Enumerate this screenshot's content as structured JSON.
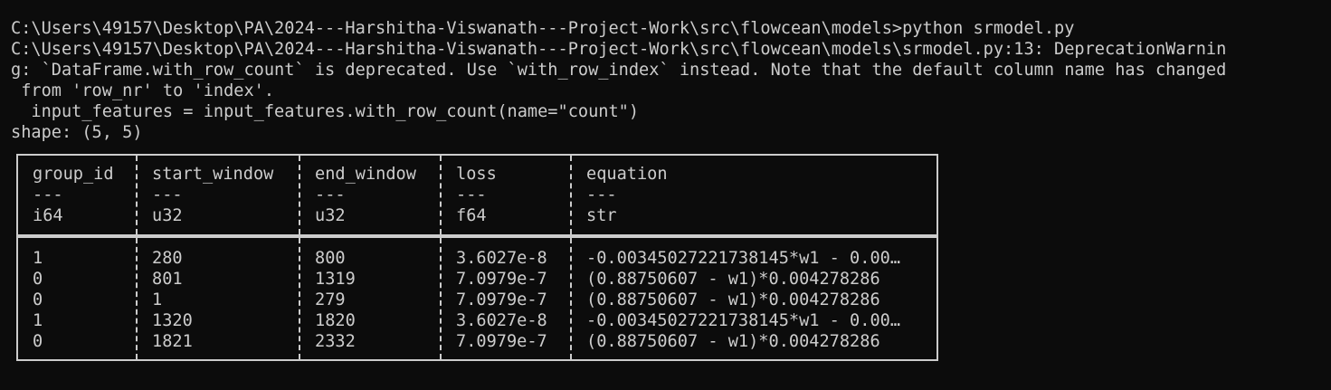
{
  "terminal": {
    "lines": [
      "C:\\Users\\49157\\Desktop\\PA\\2024---Harshitha-Viswanath---Project-Work\\src\\flowcean\\models>python srmodel.py",
      "C:\\Users\\49157\\Desktop\\PA\\2024---Harshitha-Viswanath---Project-Work\\src\\flowcean\\models\\srmodel.py:13: DeprecationWarnin",
      "g: `DataFrame.with_row_count` is deprecated. Use `with_row_index` instead. Note that the default column name has changed",
      " from 'row_nr' to 'index'.",
      "  input_features = input_features.with_row_count(name=\"count\")",
      "shape: (5, 5)"
    ],
    "colors": {
      "background": "#0c0c0c",
      "foreground": "#cccccc"
    }
  },
  "table": {
    "columns": [
      {
        "name": "group_id",
        "sep": "---",
        "dtype": "i64"
      },
      {
        "name": "start_window",
        "sep": "---",
        "dtype": "u32"
      },
      {
        "name": "end_window",
        "sep": "---",
        "dtype": "u32"
      },
      {
        "name": "loss",
        "sep": "---",
        "dtype": "f64"
      },
      {
        "name": "equation",
        "sep": "---",
        "dtype": "str"
      }
    ],
    "rows": [
      [
        "1",
        "280",
        "800",
        "3.6027e-8",
        "-0.00345027221738145*w1 - 0.00…"
      ],
      [
        "0",
        "801",
        "1319",
        "7.0979e-7",
        "(0.88750607 - w1)*0.004278286"
      ],
      [
        "0",
        "1",
        "279",
        "7.0979e-7",
        "(0.88750607 - w1)*0.004278286"
      ],
      [
        "1",
        "1320",
        "1820",
        "3.6027e-8",
        "-0.00345027221738145*w1 - 0.00…"
      ],
      [
        "0",
        "1821",
        "2332",
        "7.0979e-7",
        "(0.88750607 - w1)*0.004278286"
      ]
    ]
  }
}
